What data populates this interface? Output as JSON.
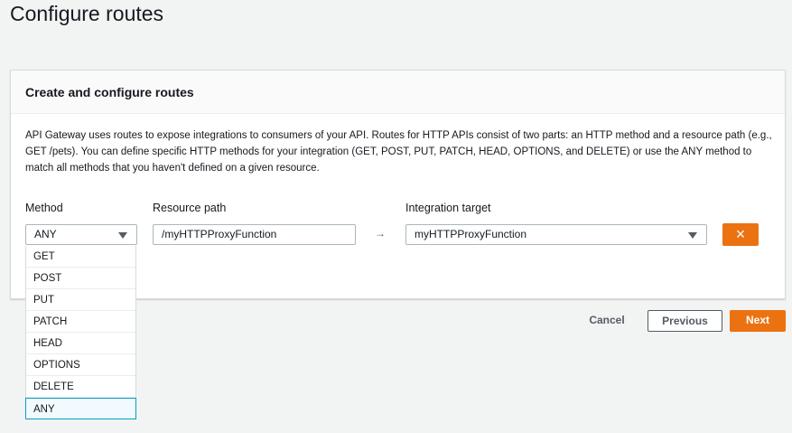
{
  "page_title": "Configure routes",
  "panel": {
    "title": "Create and configure routes",
    "description": "API Gateway uses routes to expose integrations to consumers of your API. Routes for HTTP APIs consist of two parts: an HTTP method and a resource path (e.g., GET /pets). You can define specific HTTP methods for your integration (GET, POST, PUT, PATCH, HEAD, OPTIONS, and DELETE) or use the ANY method to match all methods that you haven't defined on a given resource."
  },
  "route": {
    "method_label": "Method",
    "method_value": "ANY",
    "path_label": "Resource path",
    "path_value": "/myHTTPProxyFunction",
    "arrow": "→",
    "target_label": "Integration target",
    "target_value": "myHTTPProxyFunction",
    "remove_icon": "×"
  },
  "method_options": [
    "GET",
    "POST",
    "PUT",
    "PATCH",
    "HEAD",
    "OPTIONS",
    "DELETE",
    "ANY"
  ],
  "footer": {
    "cancel": "Cancel",
    "previous": "Previous",
    "next": "Next"
  }
}
